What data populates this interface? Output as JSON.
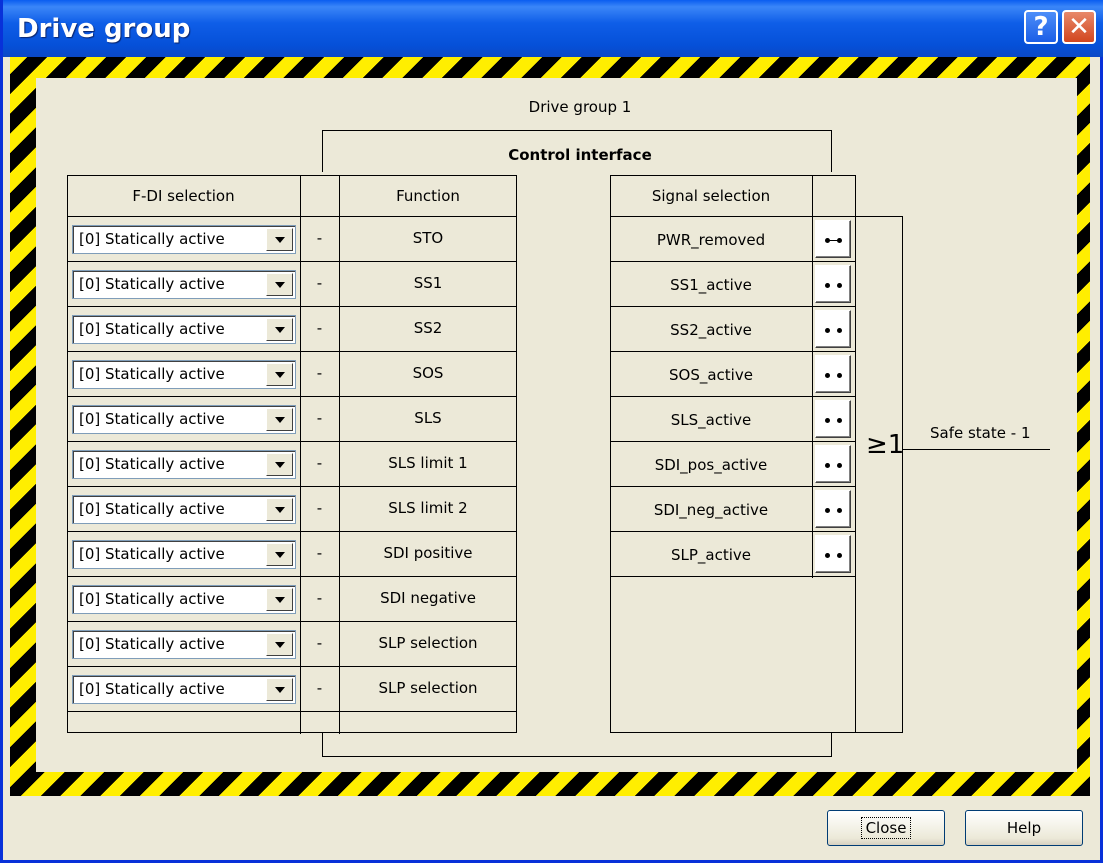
{
  "window": {
    "title": "Drive group",
    "help_button": "?",
    "close_button": "✕"
  },
  "diagram": {
    "group_title": "Drive group 1",
    "control_interface": "Control interface",
    "headers": {
      "fdi": "F-DI selection",
      "function": "Function",
      "signal": "Signal selection"
    },
    "rows": [
      {
        "select": "[0] Statically active",
        "dash": "-",
        "function": "STO"
      },
      {
        "select": "[0] Statically active",
        "dash": "-",
        "function": "SS1"
      },
      {
        "select": "[0] Statically active",
        "dash": "-",
        "function": "SS2"
      },
      {
        "select": "[0] Statically active",
        "dash": "-",
        "function": "SOS"
      },
      {
        "select": "[0] Statically active",
        "dash": "-",
        "function": "SLS"
      },
      {
        "select": "[0] Statically active",
        "dash": "-",
        "function": "SLS limit 1"
      },
      {
        "select": "[0] Statically active",
        "dash": "-",
        "function": "SLS limit 2"
      },
      {
        "select": "[0] Statically active",
        "dash": "-",
        "function": "SDI positive"
      },
      {
        "select": "[0] Statically active",
        "dash": "-",
        "function": "SDI negative"
      },
      {
        "select": "[0] Statically active",
        "dash": "-",
        "function": "SLP selection"
      },
      {
        "select": "[0] Statically active",
        "dash": "-",
        "function": "SLP selection"
      }
    ],
    "signals": [
      {
        "name": "PWR_removed",
        "connected": true
      },
      {
        "name": "SS1_active",
        "connected": false
      },
      {
        "name": "SS2_active",
        "connected": false
      },
      {
        "name": "SOS_active",
        "connected": false
      },
      {
        "name": "SLS_active",
        "connected": false
      },
      {
        "name": "SDI_pos_active",
        "connected": false
      },
      {
        "name": "SDI_neg_active",
        "connected": false
      },
      {
        "name": "SLP_active",
        "connected": false
      }
    ],
    "or_symbol": "≥1",
    "output_label": "Safe state - 1"
  },
  "footer": {
    "close_label": "Close",
    "help_label": "Help"
  },
  "colors": {
    "title_bar": "#0550d8",
    "hazard_yellow": "#ffee00",
    "hazard_black": "#000000",
    "dialog_bg": "#ece9d8"
  }
}
